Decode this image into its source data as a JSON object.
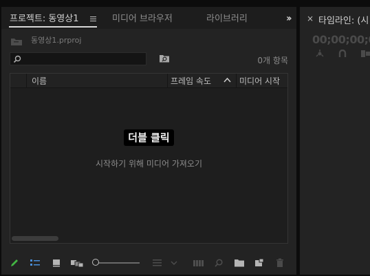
{
  "project_panel": {
    "tabs": [
      {
        "label": "프로젝트: 동영상1"
      },
      {
        "label": "미디어 브라우저"
      },
      {
        "label": "라이브러리"
      }
    ],
    "overflow_icon": "double-chevron-right-icon",
    "file_name": "동영상1.prproj",
    "search": {
      "value": "",
      "placeholder": ""
    },
    "item_count": "0개 항목",
    "columns": [
      "이름",
      "프레임 속도",
      "미디어 시작"
    ],
    "placeholder_title": "더블 클릭",
    "placeholder_subtitle": "시작하기 위해 미디어 가져오기",
    "toolbar_icons": [
      "pencil-icon",
      "list-view-icon",
      "icon-view-icon",
      "freeform-view-icon",
      "zoom-slider",
      "sort-icon",
      "chevron-down-icon",
      "automate-to-sequence-icon",
      "find-icon",
      "new-bin-icon",
      "new-item-icon",
      "trash-icon"
    ]
  },
  "timeline_panel": {
    "tab_label": "타임라인: (시",
    "close_icon": "close-icon",
    "timecode": "00;00;00;00"
  },
  "colors": {
    "panel_bg": "#232323",
    "active_tab_text": "#d2d2d2",
    "accent_blue": "#4a8fdb",
    "accent_green": "#43b643"
  }
}
